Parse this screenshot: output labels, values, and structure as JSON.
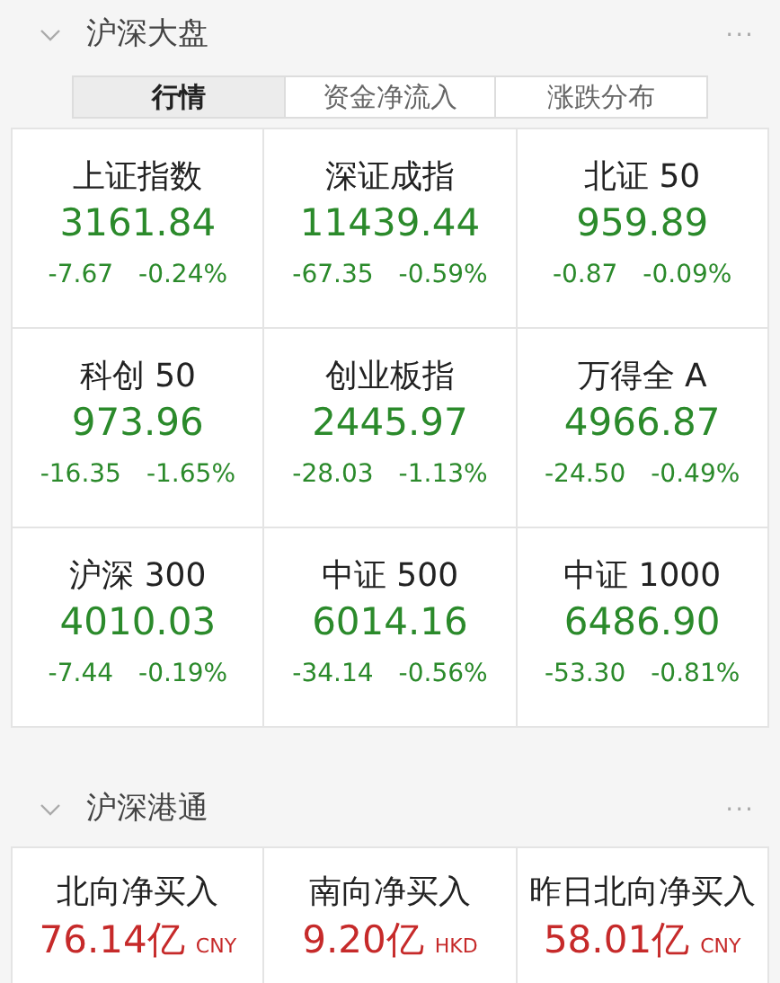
{
  "sections": [
    {
      "title": "沪深大盘",
      "expanded": true,
      "more": "···",
      "tabs": [
        {
          "label": "行情",
          "selected": true
        },
        {
          "label": "资金净流入",
          "selected": false
        },
        {
          "label": "涨跌分布",
          "selected": false
        }
      ],
      "kind": "index",
      "items": [
        {
          "name": "上证指数",
          "value": "3161.84",
          "change": "-7.67",
          "percent": "-0.24%",
          "color": "#2b8a2b"
        },
        {
          "name": "深证成指",
          "value": "11439.44",
          "change": "-67.35",
          "percent": "-0.59%",
          "color": "#2b8a2b"
        },
        {
          "name": "北证 50",
          "value": "959.89",
          "change": "-0.87",
          "percent": "-0.09%",
          "color": "#2b8a2b"
        },
        {
          "name": "科创 50",
          "value": "973.96",
          "change": "-16.35",
          "percent": "-1.65%",
          "color": "#2b8a2b"
        },
        {
          "name": "创业板指",
          "value": "2445.97",
          "change": "-28.03",
          "percent": "-1.13%",
          "color": "#2b8a2b"
        },
        {
          "name": "万得全 A",
          "value": "4966.87",
          "change": "-24.50",
          "percent": "-0.49%",
          "color": "#2b8a2b"
        },
        {
          "name": "沪深 300",
          "value": "4010.03",
          "change": "-7.44",
          "percent": "-0.19%",
          "color": "#2b8a2b"
        },
        {
          "name": "中证 500",
          "value": "6014.16",
          "change": "-34.14",
          "percent": "-0.56%",
          "color": "#2b8a2b"
        },
        {
          "name": "中证 1000",
          "value": "6486.90",
          "change": "-53.30",
          "percent": "-0.81%",
          "color": "#2b8a2b"
        }
      ]
    },
    {
      "title": "沪深港通",
      "expanded": true,
      "more": "···",
      "kind": "flow",
      "items": [
        {
          "name": "北向净买入",
          "value": "76.14亿",
          "unit": "CNY",
          "color": "#c62a2a"
        },
        {
          "name": "南向净买入",
          "value": "9.20亿",
          "unit": "HKD",
          "color": "#c62a2a"
        },
        {
          "name": "昨日北向净买入",
          "value": "58.01亿",
          "unit": "CNY",
          "color": "#c62a2a"
        }
      ]
    }
  ]
}
